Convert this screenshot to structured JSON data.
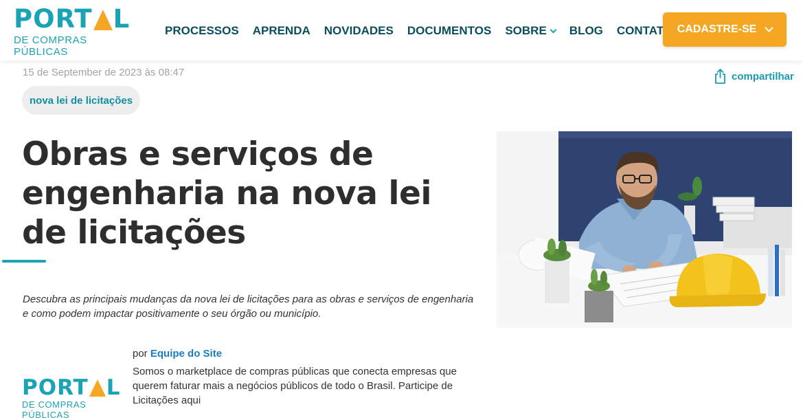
{
  "brand": {
    "name_part1": "PORT",
    "name_part2": "L",
    "subtitle": "DE COMPRAS PÚBLICAS"
  },
  "nav": {
    "items": [
      {
        "label": "PROCESSOS",
        "has_dropdown": false
      },
      {
        "label": "APRENDA",
        "has_dropdown": false
      },
      {
        "label": "NOVIDADES",
        "has_dropdown": false
      },
      {
        "label": "DOCUMENTOS",
        "has_dropdown": false
      },
      {
        "label": "SOBRE",
        "has_dropdown": true
      },
      {
        "label": "BLOG",
        "has_dropdown": false
      },
      {
        "label": "CONTATO",
        "has_dropdown": true
      }
    ],
    "cta_label": "CADASTRE-SE"
  },
  "article": {
    "date": "15 de September de 2023 às 08:47",
    "share_label": "compartilhar",
    "tag": "nova lei de licitações",
    "title": "Obras e serviços de engenharia na nova lei de licitações",
    "lede": "Descubra as principais mudanças da nova lei de licitações para as obras e serviços de engenharia e como podem impactar positivamente o seu órgão ou município.",
    "hero_alt": "engineer-at-desk-photo"
  },
  "author": {
    "by_prefix": "por",
    "name": "Equipe do Site",
    "bio": "Somos o marketplace de compras públicas que conecta empresas que querem faturar mais a negócios públicos de todo o Brasil. Participe de Licitações aqui"
  },
  "colors": {
    "brand_teal": "#1aa3b5",
    "brand_orange": "#f5a623",
    "nav_text": "#0b4d5c",
    "title_text": "#2e2e2e"
  }
}
